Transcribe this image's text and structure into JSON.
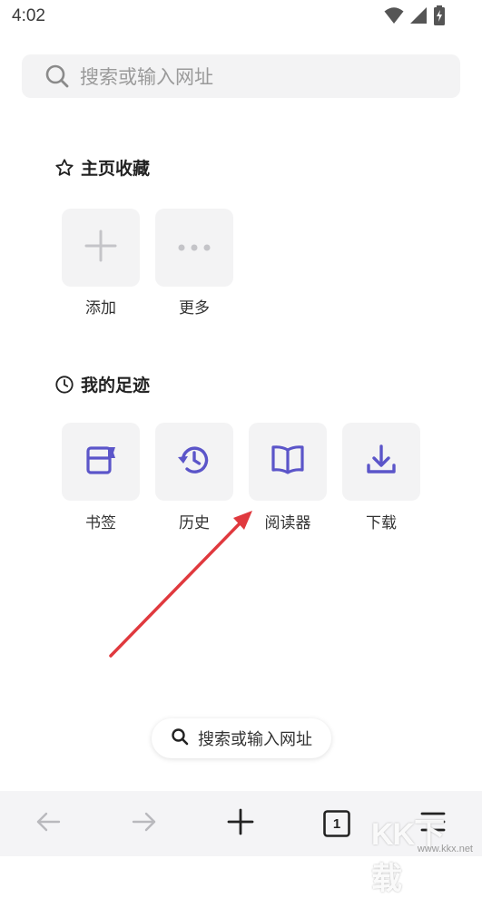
{
  "status_bar": {
    "time": "4:02",
    "icons": [
      "wifi-icon",
      "signal-icon",
      "battery-charging-icon"
    ]
  },
  "search": {
    "placeholder": "搜索或输入网址"
  },
  "favorites": {
    "title": "主页收藏",
    "items": [
      {
        "label": "添加",
        "icon": "plus-icon"
      },
      {
        "label": "更多",
        "icon": "more-dots-icon"
      }
    ]
  },
  "footprints": {
    "title": "我的足迹",
    "items": [
      {
        "label": "书签",
        "icon": "bookmark-icon"
      },
      {
        "label": "历史",
        "icon": "history-icon"
      },
      {
        "label": "阅读器",
        "icon": "reader-book-icon"
      },
      {
        "label": "下载",
        "icon": "download-icon"
      }
    ]
  },
  "floating_search": {
    "label": "搜索或输入网址"
  },
  "bottom_nav": {
    "tab_count": "1",
    "buttons": [
      "back-icon",
      "forward-icon",
      "new-tab-icon",
      "tabs-icon",
      "menu-icon"
    ]
  },
  "colors": {
    "accent": "#5b55c9",
    "tile_bg": "#f3f3f4",
    "annotation_arrow": "#e0393e"
  },
  "watermark": {
    "logo": "KK下载",
    "url": "www.kkx.net"
  }
}
